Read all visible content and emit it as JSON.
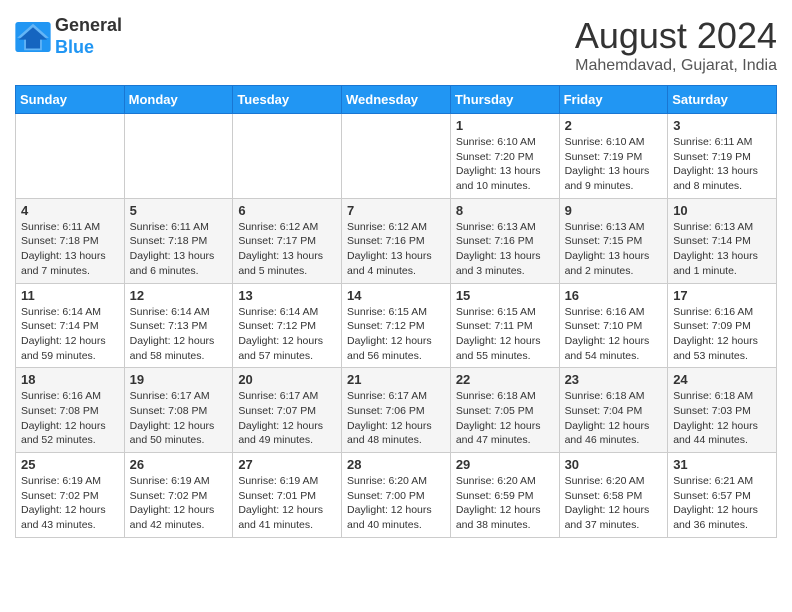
{
  "logo": {
    "line1": "General",
    "line2": "Blue"
  },
  "title": "August 2024",
  "subtitle": "Mahemdavad, Gujarat, India",
  "weekdays": [
    "Sunday",
    "Monday",
    "Tuesday",
    "Wednesday",
    "Thursday",
    "Friday",
    "Saturday"
  ],
  "weeks": [
    [
      {
        "day": "",
        "info": ""
      },
      {
        "day": "",
        "info": ""
      },
      {
        "day": "",
        "info": ""
      },
      {
        "day": "",
        "info": ""
      },
      {
        "day": "1",
        "info": "Sunrise: 6:10 AM\nSunset: 7:20 PM\nDaylight: 13 hours\nand 10 minutes."
      },
      {
        "day": "2",
        "info": "Sunrise: 6:10 AM\nSunset: 7:19 PM\nDaylight: 13 hours\nand 9 minutes."
      },
      {
        "day": "3",
        "info": "Sunrise: 6:11 AM\nSunset: 7:19 PM\nDaylight: 13 hours\nand 8 minutes."
      }
    ],
    [
      {
        "day": "4",
        "info": "Sunrise: 6:11 AM\nSunset: 7:18 PM\nDaylight: 13 hours\nand 7 minutes."
      },
      {
        "day": "5",
        "info": "Sunrise: 6:11 AM\nSunset: 7:18 PM\nDaylight: 13 hours\nand 6 minutes."
      },
      {
        "day": "6",
        "info": "Sunrise: 6:12 AM\nSunset: 7:17 PM\nDaylight: 13 hours\nand 5 minutes."
      },
      {
        "day": "7",
        "info": "Sunrise: 6:12 AM\nSunset: 7:16 PM\nDaylight: 13 hours\nand 4 minutes."
      },
      {
        "day": "8",
        "info": "Sunrise: 6:13 AM\nSunset: 7:16 PM\nDaylight: 13 hours\nand 3 minutes."
      },
      {
        "day": "9",
        "info": "Sunrise: 6:13 AM\nSunset: 7:15 PM\nDaylight: 13 hours\nand 2 minutes."
      },
      {
        "day": "10",
        "info": "Sunrise: 6:13 AM\nSunset: 7:14 PM\nDaylight: 13 hours\nand 1 minute."
      }
    ],
    [
      {
        "day": "11",
        "info": "Sunrise: 6:14 AM\nSunset: 7:14 PM\nDaylight: 12 hours\nand 59 minutes."
      },
      {
        "day": "12",
        "info": "Sunrise: 6:14 AM\nSunset: 7:13 PM\nDaylight: 12 hours\nand 58 minutes."
      },
      {
        "day": "13",
        "info": "Sunrise: 6:14 AM\nSunset: 7:12 PM\nDaylight: 12 hours\nand 57 minutes."
      },
      {
        "day": "14",
        "info": "Sunrise: 6:15 AM\nSunset: 7:12 PM\nDaylight: 12 hours\nand 56 minutes."
      },
      {
        "day": "15",
        "info": "Sunrise: 6:15 AM\nSunset: 7:11 PM\nDaylight: 12 hours\nand 55 minutes."
      },
      {
        "day": "16",
        "info": "Sunrise: 6:16 AM\nSunset: 7:10 PM\nDaylight: 12 hours\nand 54 minutes."
      },
      {
        "day": "17",
        "info": "Sunrise: 6:16 AM\nSunset: 7:09 PM\nDaylight: 12 hours\nand 53 minutes."
      }
    ],
    [
      {
        "day": "18",
        "info": "Sunrise: 6:16 AM\nSunset: 7:08 PM\nDaylight: 12 hours\nand 52 minutes."
      },
      {
        "day": "19",
        "info": "Sunrise: 6:17 AM\nSunset: 7:08 PM\nDaylight: 12 hours\nand 50 minutes."
      },
      {
        "day": "20",
        "info": "Sunrise: 6:17 AM\nSunset: 7:07 PM\nDaylight: 12 hours\nand 49 minutes."
      },
      {
        "day": "21",
        "info": "Sunrise: 6:17 AM\nSunset: 7:06 PM\nDaylight: 12 hours\nand 48 minutes."
      },
      {
        "day": "22",
        "info": "Sunrise: 6:18 AM\nSunset: 7:05 PM\nDaylight: 12 hours\nand 47 minutes."
      },
      {
        "day": "23",
        "info": "Sunrise: 6:18 AM\nSunset: 7:04 PM\nDaylight: 12 hours\nand 46 minutes."
      },
      {
        "day": "24",
        "info": "Sunrise: 6:18 AM\nSunset: 7:03 PM\nDaylight: 12 hours\nand 44 minutes."
      }
    ],
    [
      {
        "day": "25",
        "info": "Sunrise: 6:19 AM\nSunset: 7:02 PM\nDaylight: 12 hours\nand 43 minutes."
      },
      {
        "day": "26",
        "info": "Sunrise: 6:19 AM\nSunset: 7:02 PM\nDaylight: 12 hours\nand 42 minutes."
      },
      {
        "day": "27",
        "info": "Sunrise: 6:19 AM\nSunset: 7:01 PM\nDaylight: 12 hours\nand 41 minutes."
      },
      {
        "day": "28",
        "info": "Sunrise: 6:20 AM\nSunset: 7:00 PM\nDaylight: 12 hours\nand 40 minutes."
      },
      {
        "day": "29",
        "info": "Sunrise: 6:20 AM\nSunset: 6:59 PM\nDaylight: 12 hours\nand 38 minutes."
      },
      {
        "day": "30",
        "info": "Sunrise: 6:20 AM\nSunset: 6:58 PM\nDaylight: 12 hours\nand 37 minutes."
      },
      {
        "day": "31",
        "info": "Sunrise: 6:21 AM\nSunset: 6:57 PM\nDaylight: 12 hours\nand 36 minutes."
      }
    ]
  ]
}
